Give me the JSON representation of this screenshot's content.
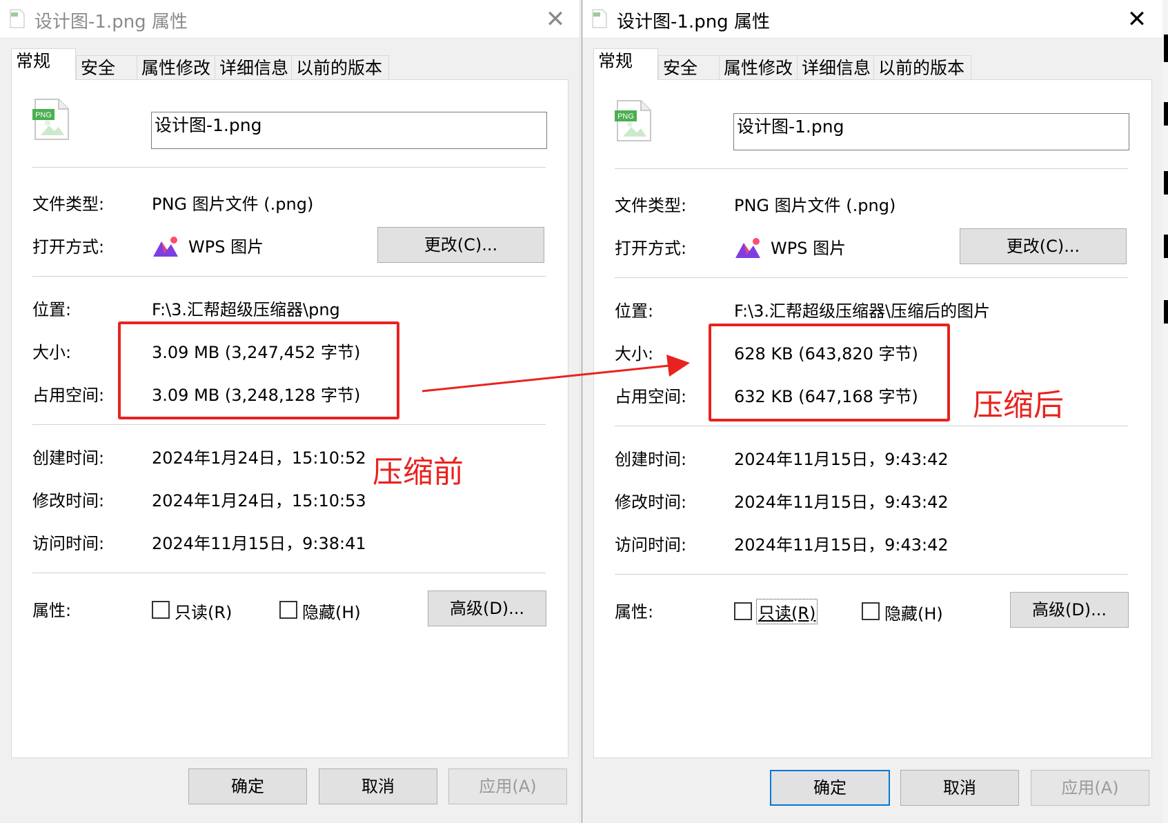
{
  "left": {
    "title": "设计图-1.png 属性",
    "tabs": [
      "常规",
      "安全",
      "属性修改",
      "详细信息",
      "以前的版本"
    ],
    "file_name": "设计图-1.png",
    "labels": {
      "type": "文件类型:",
      "open_with": "打开方式:",
      "location": "位置:",
      "size": "大小:",
      "size_on_disk": "占用空间:",
      "created": "创建时间:",
      "modified": "修改时间:",
      "accessed": "访问时间:",
      "attributes": "属性:"
    },
    "values": {
      "type": "PNG 图片文件 (.png)",
      "open_with": "WPS 图片",
      "location": "F:\\3.汇帮超级压缩器\\png",
      "size": "3.09 MB (3,247,452 字节)",
      "size_on_disk": "3.09 MB (3,248,128 字节)",
      "created": "2024年1月24日，15:10:52",
      "modified": "2024年1月24日，15:10:53",
      "accessed": "2024年11月15日，9:38:41"
    },
    "change_button": "更改(C)...",
    "readonly_label": "只读(R)",
    "hidden_label": "隐藏(H)",
    "advanced_button": "高级(D)...",
    "ok_button": "确定",
    "cancel_button": "取消",
    "apply_button": "应用(A)",
    "annotation": "压缩前",
    "close_glyph": "✕"
  },
  "right": {
    "title": "设计图-1.png 属性",
    "tabs": [
      "常规",
      "安全",
      "属性修改",
      "详细信息",
      "以前的版本"
    ],
    "file_name": "设计图-1.png",
    "labels": {
      "type": "文件类型:",
      "open_with": "打开方式:",
      "location": "位置:",
      "size": "大小:",
      "size_on_disk": "占用空间:",
      "created": "创建时间:",
      "modified": "修改时间:",
      "accessed": "访问时间:",
      "attributes": "属性:"
    },
    "values": {
      "type": "PNG 图片文件 (.png)",
      "open_with": "WPS 图片",
      "location": "F:\\3.汇帮超级压缩器\\压缩后的图片",
      "size": "628 KB (643,820 字节)",
      "size_on_disk": "632 KB (647,168 字节)",
      "created": "2024年11月15日，9:43:42",
      "modified": "2024年11月15日，9:43:42",
      "accessed": "2024年11月15日，9:43:42"
    },
    "change_button": "更改(C)...",
    "readonly_label": "只读(R)",
    "hidden_label": "隐藏(H)",
    "advanced_button": "高级(D)...",
    "ok_button": "确定",
    "cancel_button": "取消",
    "apply_button": "应用(A)",
    "annotation": "压缩后",
    "close_glyph": "✕"
  },
  "icons": {
    "file_icon": "png-file-icon",
    "app_icon": "wps-picture-icon",
    "arrow": "red-arrow-annotation"
  },
  "colors": {
    "annotation_red": "#e8221e",
    "focus_blue": "#0078d7",
    "png_badge_green": "#4caf50"
  },
  "file_icon_badge": "PNG"
}
